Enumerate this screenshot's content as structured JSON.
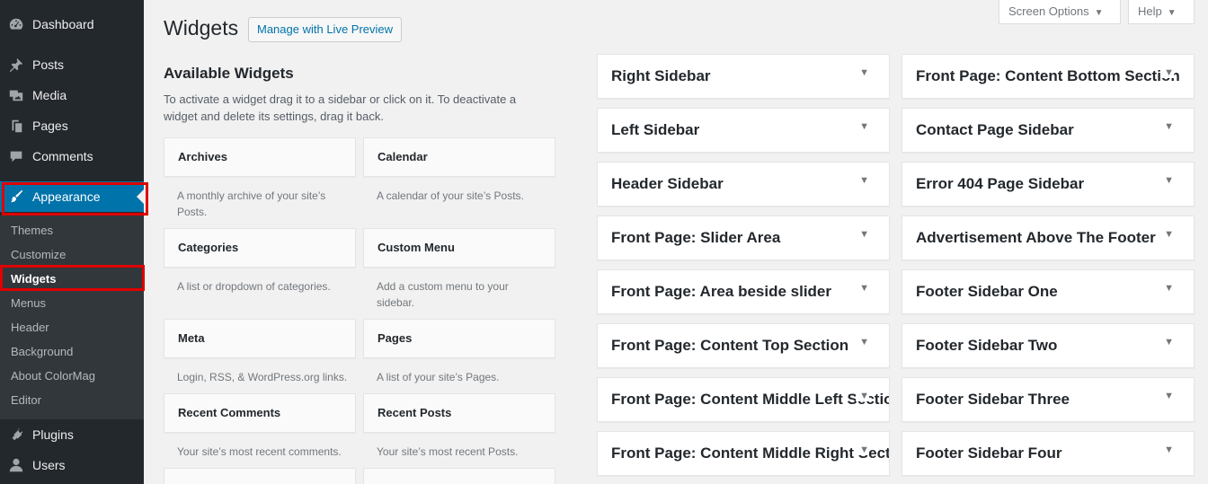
{
  "menu": {
    "dashboard": "Dashboard",
    "posts": "Posts",
    "media": "Media",
    "pages": "Pages",
    "comments": "Comments",
    "appearance": "Appearance",
    "plugins": "Plugins",
    "users": "Users"
  },
  "submenu": {
    "themes": "Themes",
    "customize": "Customize",
    "widgets": "Widgets",
    "menus": "Menus",
    "header": "Header",
    "background": "Background",
    "about": "About ColorMag",
    "editor": "Editor"
  },
  "header": {
    "title": "Widgets",
    "live_preview": "Manage with Live Preview",
    "screen_options": "Screen Options",
    "help": "Help"
  },
  "available": {
    "title": "Available Widgets",
    "description": "To activate a widget drag it to a sidebar or click on it. To deactivate a widget and delete its settings, drag it back.",
    "widgets": [
      {
        "name": "Archives",
        "desc": "A monthly archive of your site’s Posts."
      },
      {
        "name": "Calendar",
        "desc": "A calendar of your site’s Posts."
      },
      {
        "name": "Categories",
        "desc": "A list or dropdown of categories."
      },
      {
        "name": "Custom Menu",
        "desc": "Add a custom menu to your sidebar."
      },
      {
        "name": "Meta",
        "desc": "Login, RSS, & WordPress.org links."
      },
      {
        "name": "Pages",
        "desc": "A list of your site’s Pages."
      },
      {
        "name": "Recent Comments",
        "desc": "Your site’s most recent comments."
      },
      {
        "name": "Recent Posts",
        "desc": "Your site’s most recent Posts."
      }
    ]
  },
  "sidebars": {
    "left_column": [
      "Right Sidebar",
      "Left Sidebar",
      "Header Sidebar",
      "Front Page: Slider Area",
      "Front Page: Area beside slider",
      "Front Page: Content Top Section",
      "Front Page: Content Middle Left Section",
      "Front Page: Content Middle Right Section"
    ],
    "right_column": [
      "Front Page: Content Bottom Section",
      "Contact Page Sidebar",
      "Error 404 Page Sidebar",
      "Advertisement Above The Footer",
      "Footer Sidebar One",
      "Footer Sidebar Two",
      "Footer Sidebar Three",
      "Footer Sidebar Four"
    ]
  },
  "colors": {
    "menu_bg": "#23282d",
    "submenu_bg": "#32373c",
    "accent": "#0073aa",
    "highlight": "#e00000"
  }
}
